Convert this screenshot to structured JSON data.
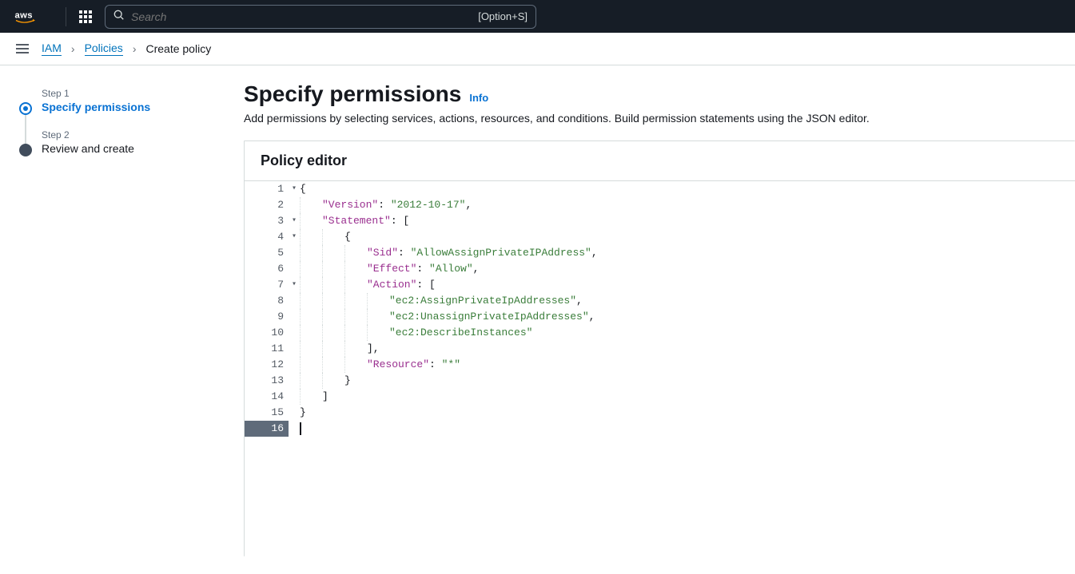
{
  "topbar": {
    "logo": "aws",
    "search_placeholder": "Search",
    "search_shortcut": "[Option+S]"
  },
  "breadcrumb": {
    "items": [
      {
        "label": "IAM",
        "link": true
      },
      {
        "label": "Policies",
        "link": true
      },
      {
        "label": "Create policy",
        "link": false
      }
    ]
  },
  "steps": [
    {
      "label": "Step 1",
      "title": "Specify permissions",
      "active": true
    },
    {
      "label": "Step 2",
      "title": "Review and create",
      "active": false
    }
  ],
  "page": {
    "title": "Specify permissions",
    "info": "Info",
    "description": "Add permissions by selecting services, actions, resources, and conditions. Build permission statements using the JSON editor."
  },
  "panel": {
    "header": "Policy editor"
  },
  "editor": {
    "current_line": 16,
    "lines": [
      {
        "n": 1,
        "fold": true,
        "indent": 0,
        "tokens": [
          [
            "punc",
            "{"
          ]
        ]
      },
      {
        "n": 2,
        "fold": false,
        "indent": 1,
        "tokens": [
          [
            "key",
            "\"Version\""
          ],
          [
            "punc",
            ": "
          ],
          [
            "str",
            "\"2012-10-17\""
          ],
          [
            "punc",
            ","
          ]
        ]
      },
      {
        "n": 3,
        "fold": true,
        "indent": 1,
        "tokens": [
          [
            "key",
            "\"Statement\""
          ],
          [
            "punc",
            ": ["
          ]
        ]
      },
      {
        "n": 4,
        "fold": true,
        "indent": 2,
        "tokens": [
          [
            "punc",
            "{"
          ]
        ]
      },
      {
        "n": 5,
        "fold": false,
        "indent": 3,
        "tokens": [
          [
            "key",
            "\"Sid\""
          ],
          [
            "punc",
            ": "
          ],
          [
            "str",
            "\"AllowAssignPrivateIPAddress\""
          ],
          [
            "punc",
            ","
          ]
        ]
      },
      {
        "n": 6,
        "fold": false,
        "indent": 3,
        "tokens": [
          [
            "key",
            "\"Effect\""
          ],
          [
            "punc",
            ": "
          ],
          [
            "str",
            "\"Allow\""
          ],
          [
            "punc",
            ","
          ]
        ]
      },
      {
        "n": 7,
        "fold": true,
        "indent": 3,
        "tokens": [
          [
            "key",
            "\"Action\""
          ],
          [
            "punc",
            ": ["
          ]
        ]
      },
      {
        "n": 8,
        "fold": false,
        "indent": 4,
        "tokens": [
          [
            "str",
            "\"ec2:AssignPrivateIpAddresses\""
          ],
          [
            "punc",
            ","
          ]
        ]
      },
      {
        "n": 9,
        "fold": false,
        "indent": 4,
        "tokens": [
          [
            "str",
            "\"ec2:UnassignPrivateIpAddresses\""
          ],
          [
            "punc",
            ","
          ]
        ]
      },
      {
        "n": 10,
        "fold": false,
        "indent": 4,
        "tokens": [
          [
            "str",
            "\"ec2:DescribeInstances\""
          ]
        ]
      },
      {
        "n": 11,
        "fold": false,
        "indent": 3,
        "tokens": [
          [
            "punc",
            "],"
          ]
        ]
      },
      {
        "n": 12,
        "fold": false,
        "indent": 3,
        "tokens": [
          [
            "key",
            "\"Resource\""
          ],
          [
            "punc",
            ": "
          ],
          [
            "str",
            "\"*\""
          ]
        ]
      },
      {
        "n": 13,
        "fold": false,
        "indent": 2,
        "tokens": [
          [
            "punc",
            "}"
          ]
        ]
      },
      {
        "n": 14,
        "fold": false,
        "indent": 1,
        "tokens": [
          [
            "punc",
            "]"
          ]
        ]
      },
      {
        "n": 15,
        "fold": false,
        "indent": 0,
        "tokens": [
          [
            "punc",
            "}"
          ]
        ]
      },
      {
        "n": 16,
        "fold": false,
        "indent": 0,
        "tokens": []
      }
    ]
  }
}
